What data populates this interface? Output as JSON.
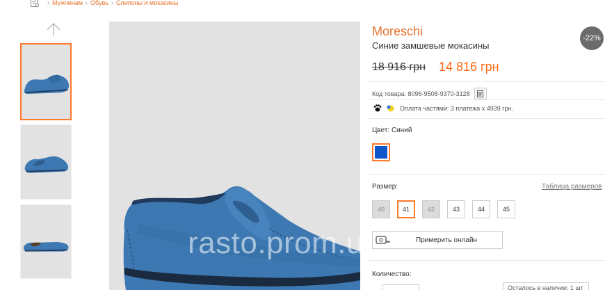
{
  "breadcrumb": {
    "home_icon": "catalog-icon",
    "items": [
      "Мужчинам",
      "Обувь",
      "Слипоны и мокасины"
    ],
    "color": "#e8722c"
  },
  "gallery": {
    "up_arrow_icon": "arrow-up-icon",
    "thumbnails": [
      "thumb-1",
      "thumb-2",
      "thumb-3"
    ],
    "active_index": 0
  },
  "watermark": "rasto.prom.ua",
  "product": {
    "brand": "Moreschi",
    "name": "Синие замшевые мокасины",
    "discount_badge": "-22%",
    "old_price": "18 916 грн",
    "new_price": "14 816 грн",
    "sku_label": "Код товара: 8096-9508-9370-3128",
    "payment_text": "Оплата частями: 3 платежа х 4939 грн.",
    "color_label": "Цвет: Синий",
    "selected_color": "#0d55c9",
    "size_label": "Размер:",
    "size_table_link": "Таблица размеров",
    "sizes": [
      {
        "value": "40",
        "available": false,
        "selected": false
      },
      {
        "value": "41",
        "available": true,
        "selected": true
      },
      {
        "value": "42",
        "available": false,
        "selected": false
      },
      {
        "value": "43",
        "available": true,
        "selected": false
      },
      {
        "value": "44",
        "available": true,
        "selected": false
      },
      {
        "value": "45",
        "available": true,
        "selected": false
      }
    ],
    "try_on_label": "Примерить онлайн",
    "quantity_label": "Количество:",
    "stock_text": "Осталось в наличии: 1 шт"
  },
  "colors": {
    "accent": "#ff6a14",
    "shoe": "#3d78b2"
  }
}
